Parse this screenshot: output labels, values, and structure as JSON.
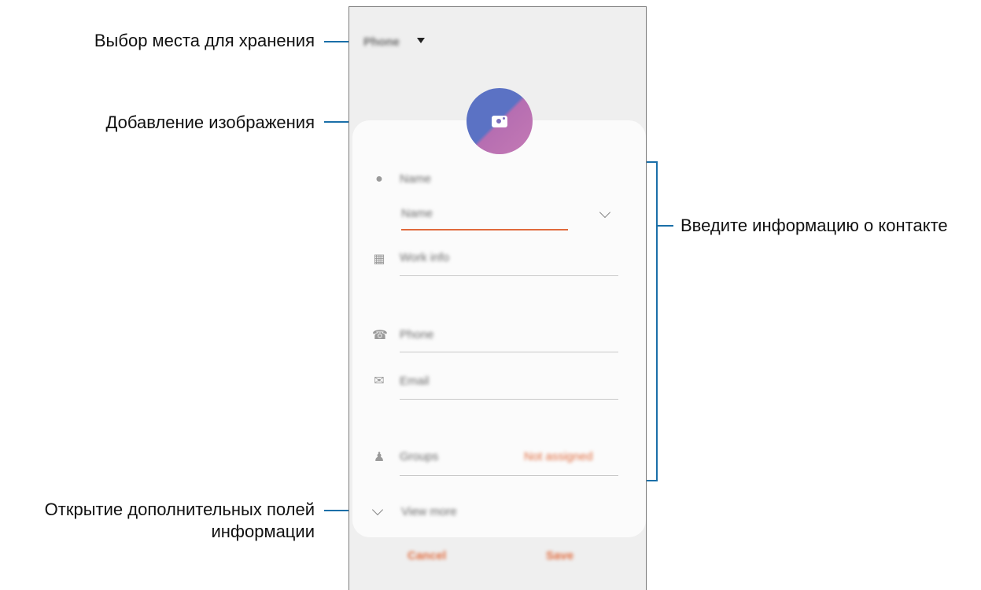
{
  "callouts": {
    "storage": "Выбор места для хранения",
    "image": "Добавление изображения",
    "contact_info": "Введите информацию о контакте",
    "more_fields_line1": "Открытие дополнительных полей",
    "more_fields_line2": "информации"
  },
  "phone": {
    "storage_selector": "Phone",
    "fields": {
      "name_label": "Name",
      "name_input_placeholder": "Name",
      "work_info": "Work info",
      "phone": "Phone",
      "email": "Email",
      "groups": "Groups",
      "groups_value": "Not assigned",
      "view_more": "View more"
    },
    "buttons": {
      "cancel": "Cancel",
      "save": "Save"
    }
  },
  "colors": {
    "accent": "#e06a3c",
    "leader": "#1a6fa8",
    "avatar_blue": "#5b72c4",
    "avatar_pink": "#c47ab5"
  },
  "icons": [
    "person-icon",
    "building-icon",
    "phone-icon",
    "email-icon",
    "groups-icon",
    "chevron-down-icon",
    "camera-icon",
    "dropdown-arrow-icon"
  ]
}
